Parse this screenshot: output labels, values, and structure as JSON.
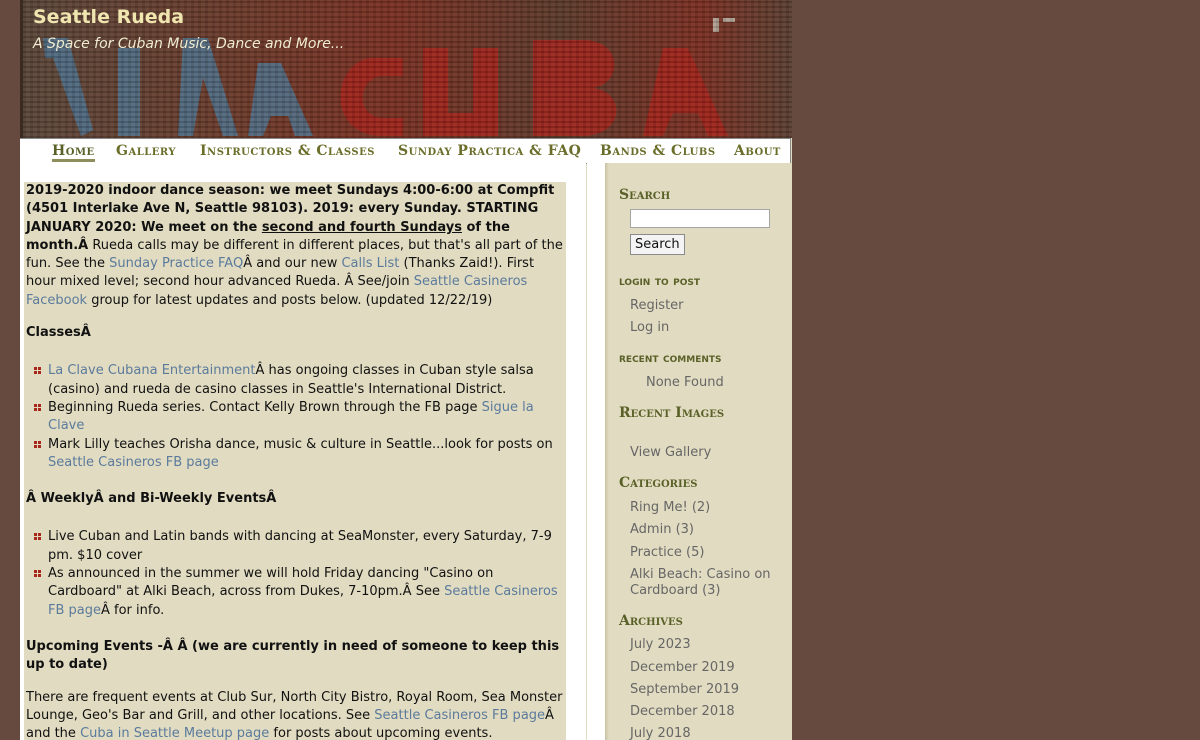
{
  "site": {
    "title": "Seattle Rueda",
    "slogan": "A Space for Cuban Music, Dance and More..."
  },
  "nav": [
    {
      "label": "Home",
      "active": true
    },
    {
      "label": "Gallery"
    },
    {
      "label": "Instructors & Classes"
    },
    {
      "label": "Sunday Practica & FAQ"
    },
    {
      "label": "Bands & Clubs"
    },
    {
      "label": "About"
    }
  ],
  "content": {
    "intro_bold_1": "2019-2020 indoor dance season: we meet Sundays 4:00-6:00 at Compfit (4501 Interlake Ave N, Seattle 98103). 2019: every Sunday. STARTING JANUARY 2020: We meet on the ",
    "intro_underlined": "second and fourth Sundays",
    "intro_bold_2": " of the month.Â",
    "intro_text_1": " Rueda calls may be different in different places, but that's all part of the fun. See the ",
    "faq_link": "Sunday Practice FAQ",
    "intro_text_2": "Â and our new ",
    "calls_link": "Calls List",
    "intro_text_3": " (Thanks Zaid!). First hour mixed level; second hour advanced Rueda. Â See/join ",
    "fb_group_link": "Seattle Casineros Facebook",
    "intro_text_4": " group for latest updates and posts below. (updated 12/22/19)",
    "classes_heading": "ClassesÂ",
    "classes": [
      {
        "link": "La Clave Cubana Entertainment",
        "text": "Â has ongoing classes in Cuban style salsa (casino) and rueda de casino classes in Seattle's International District."
      },
      {
        "text": "Beginning Rueda series. Contact Kelly Brown through the FB page ",
        "link_after": "Sigue la Clave"
      },
      {
        "text": "Mark Lilly teaches Orisha dance, music & culture in Seattle...look for posts on ",
        "link_after": "Seattle Casineros FB page"
      }
    ],
    "weekly_heading": "Â WeeklyÂ and Bi-Weekly EventsÂ",
    "weekly": [
      {
        "text": "Live Cuban and Latin bands with dancing at SeaMonster, every Saturday, 7-9 pm. $10 cover"
      },
      {
        "text": "As announced in the summer we will hold Friday dancing \"Casino on Cardboard\" at Alki Beach, across from Dukes, 7-10pm.Â  See ",
        "link": "Seattle Casineros FB page",
        "text_after": "Â for info."
      }
    ],
    "upcoming_heading": "Upcoming Events -Â Â (we are currently in need of someone to keep this up to date)",
    "upcoming_text_1": "There are frequent events at Club Sur, North City Bistro, Royal Room, Sea Monster Lounge, Geo's Bar and Grill, and other locations. See ",
    "upcoming_link_1": "Seattle Casineros FB page",
    "upcoming_text_2": "Â and the ",
    "upcoming_link_2": "Cuba in Seattle Meetup page",
    "upcoming_text_3": " for posts about upcoming events."
  },
  "sidebar": {
    "search_heading": "Search",
    "search_value": "",
    "search_button": "Search",
    "login_heading": "login to post",
    "login_links": [
      "Register",
      "Log in"
    ],
    "comments_heading": "recent comments",
    "comments_none": "None Found",
    "images_heading": "Recent Images",
    "view_gallery": "View Gallery",
    "categories_heading": "Categories",
    "categories": [
      "Ring Me! (2)",
      "Admin (3)",
      "Practice (5)",
      "Alki Beach: Casino on",
      "Cardboard (3)"
    ],
    "archives_heading": "Archives",
    "archives": [
      "July 2023",
      "December 2019",
      "September 2019",
      "December 2018",
      "July 2018"
    ]
  },
  "colors": {
    "background": "#674a3f",
    "content_bg": "#e1dcc1",
    "link": "#5b7a9c",
    "nav_text": "#6a6e2a",
    "bullet": "#a8271b"
  }
}
